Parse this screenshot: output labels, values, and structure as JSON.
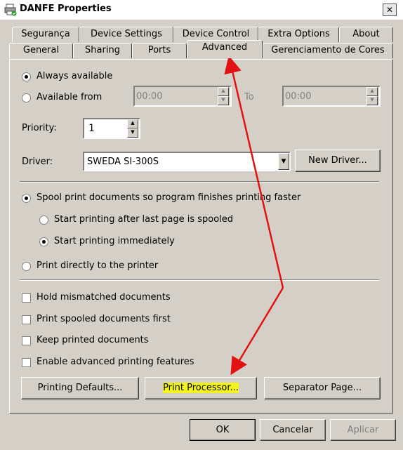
{
  "window": {
    "title": "DANFE Properties",
    "close_glyph": "✕"
  },
  "tabs_row1": [
    "Segurança",
    "Device Settings",
    "Device Control",
    "Extra Options",
    "About"
  ],
  "tabs_row2": [
    "General",
    "Sharing",
    "Ports",
    "Advanced",
    "Gerenciamento de Cores"
  ],
  "active_tab": "Advanced",
  "availability": {
    "always_label": "Always available",
    "from_label": "Available from",
    "from_time": "00:00",
    "to_label": "To",
    "to_time": "00:00",
    "selected": "always"
  },
  "priority": {
    "label": "Priority:",
    "value": "1"
  },
  "driver": {
    "label": "Driver:",
    "value": "SWEDA SI-300S",
    "new_driver_label": "New Driver..."
  },
  "spool": {
    "spool_label": "Spool print documents so program finishes printing faster",
    "after_last_label": "Start printing after last page is spooled",
    "immediately_label": "Start printing immediately",
    "direct_label": "Print directly to the printer"
  },
  "options": {
    "hold_mismatched": "Hold mismatched documents",
    "print_spooled_first": "Print spooled documents first",
    "keep_printed": "Keep printed documents",
    "enable_advanced": "Enable advanced printing features"
  },
  "buttons": {
    "printing_defaults": "Printing Defaults...",
    "print_processor": "Print Processor...",
    "separator_page": "Separator Page...",
    "ok": "OK",
    "cancel": "Cancelar",
    "apply": "Aplicar"
  },
  "colors": {
    "annotation_arrow": "#e31212",
    "highlight": "#f3f31e"
  }
}
